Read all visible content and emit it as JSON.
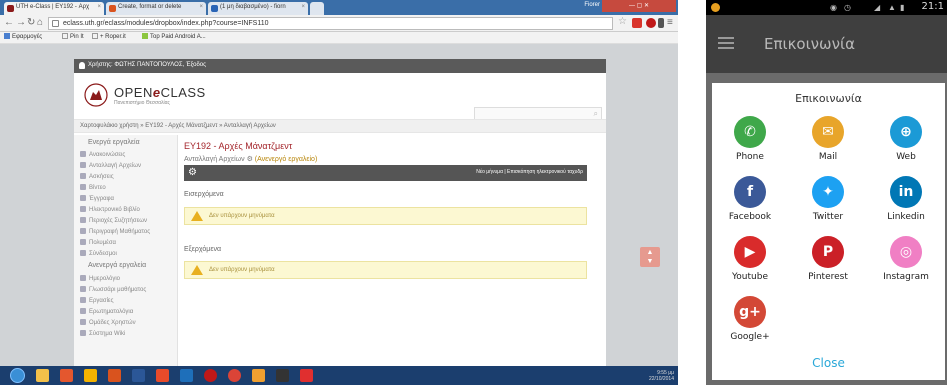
{
  "browser": {
    "tabs": [
      {
        "label": "UTH e-Class | EY192 - Αρχ"
      },
      {
        "label": "Create, format or delete"
      },
      {
        "label": "(1 μη διαβασμένο) - fiorn"
      }
    ],
    "window_user": "Fiorer",
    "url": "eclass.uth.gr/eclass/modules/dropbox/index.php?course=INFS110",
    "bookmarks": [
      "Εφαρμογές",
      "Pin It",
      "+ Roper.it",
      "Top Paid Android A..."
    ]
  },
  "page": {
    "user_bar": "Χρήστης: ΦΩΤΗΣ ΠΑΝΤΟΠΟΥΛΟΣ, Έξοδος",
    "brand_pre": "OPEN",
    "brand_e": "e",
    "brand_post": "CLASS",
    "brand_sub": "Πανεπιστήμιο Θεσσαλίας",
    "breadcrumb": "Χαρτοφυλάκιο χρήστη » ΕΥ192 - Αρχές Μάνατζμεντ » Ανταλλαγή Αρχείων",
    "sidebar": {
      "active_head": "Ενεργά εργαλεία",
      "active_items": [
        "Ανακοινώσεις",
        "Ανταλλαγή Αρχείων",
        "Ασκήσεις",
        "Βίντεο",
        "Έγγραφα",
        "Ηλεκτρονικό Βιβλίο",
        "Περιοχές Συζητήσεων",
        "Περιγραφή Μαθήματος",
        "Πολυμέσα",
        "Σύνδεσμοι"
      ],
      "inactive_head": "Ανενεργά εργαλεία",
      "inactive_items": [
        "Ημερολόγιο",
        "Γλωσσάρι μαθήματος",
        "Εργασίες",
        "Ερωτηματολόγια",
        "Ομάδες Χρηστών",
        "Σύστημα Wiki"
      ]
    },
    "course_title": "ΕΥ192 - Αρχές Μάνατζμεντ",
    "course_sub": "Ανταλλαγή Αρχείων",
    "course_sub_link": "(Ανενεργό εργαλείο)",
    "toolbar_text": "Νέο μήνυμα | Επισκόπηση ηλεκτρονικού ταχυδρ",
    "incoming_label": "Εισερχόμενα",
    "incoming_alert": "Δεν υπάρχουν μηνύματα",
    "outgoing_label": "Εξερχόμενα",
    "outgoing_alert": "Δεν υπάρχουν μηνύματα"
  },
  "taskbar": {
    "tray_time": "9:55 μμ",
    "tray_date": "22/10/2014"
  },
  "phone": {
    "clock": "21:1",
    "app_title": "Επικοινωνία",
    "sheet_title": "Επικοινωνία",
    "share_items": [
      {
        "label": "Phone",
        "icon": "phone-icon",
        "color": "#3fa84a",
        "glyph": "✆"
      },
      {
        "label": "Mail",
        "icon": "mail-icon",
        "color": "#e8a52a",
        "glyph": "✉"
      },
      {
        "label": "Web",
        "icon": "globe-icon",
        "color": "#1b9ad6",
        "glyph": "⊕"
      },
      {
        "label": "Facebook",
        "icon": "facebook-icon",
        "color": "#3b5998",
        "glyph": "f"
      },
      {
        "label": "Twitter",
        "icon": "twitter-icon",
        "color": "#1da1f2",
        "glyph": "✦"
      },
      {
        "label": "Linkedin",
        "icon": "linkedin-icon",
        "color": "#0077b5",
        "glyph": "in"
      },
      {
        "label": "Youtube",
        "icon": "youtube-icon",
        "color": "#d92b2b",
        "glyph": "▶"
      },
      {
        "label": "Pinterest",
        "icon": "pinterest-icon",
        "color": "#cb2027",
        "glyph": "P"
      },
      {
        "label": "Instagram",
        "icon": "instagram-icon",
        "color": "#f07fc4",
        "glyph": "◎"
      },
      {
        "label": "Google+",
        "icon": "googleplus-icon",
        "color": "#d34836",
        "glyph": "g+"
      }
    ],
    "close_label": "Close"
  }
}
